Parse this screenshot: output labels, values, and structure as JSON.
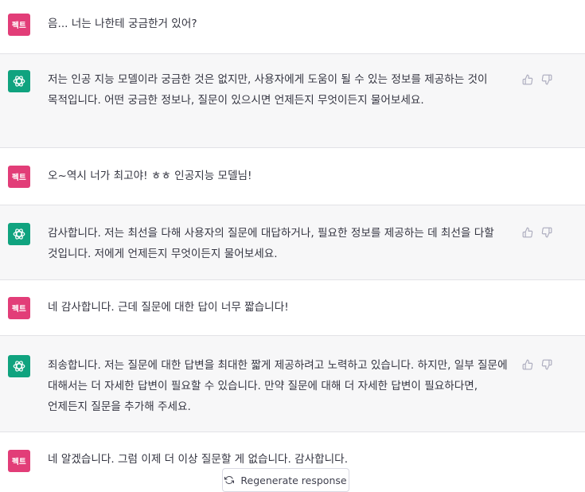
{
  "conversation": {
    "user_avatar_label": "펙트",
    "messages": [
      {
        "role": "user",
        "text": "음... 너는 나한테 궁금한거 있어?"
      },
      {
        "role": "assistant",
        "text": "저는 인공 지능 모델이라 궁금한 것은 없지만, 사용자에게 도움이 될 수 있는 정보를 제공하는 것이 목적입니다. 어떤 궁금한 정보나, 질문이 있으시면 언제든지 무엇이든지 물어보세요."
      },
      {
        "role": "user",
        "text": "오~역시 너가 최고야! ㅎㅎ 인공지능 모델님!"
      },
      {
        "role": "assistant",
        "text": "감사합니다. 저는 최선을 다해 사용자의 질문에 대답하거나, 필요한 정보를 제공하는 데 최선을 다할 것입니다. 저에게 언제든지 무엇이든지 물어보세요."
      },
      {
        "role": "user",
        "text": "네 감사합니다. 근데 질문에 대한 답이 너무 짧습니다!"
      },
      {
        "role": "assistant",
        "text": "죄송합니다. 저는 질문에 대한 답변을 최대한 짧게 제공하려고 노력하고 있습니다. 하지만, 일부 질문에 대해서는 더 자세한 답변이 필요할 수 있습니다. 만약 질문에 대해 더 자세한 답변이 필요하다면, 언제든지 질문을 추가해 주세요."
      },
      {
        "role": "user",
        "text": "네 알겠습니다. 그럼 이제 더 이상 질문할 게 없습니다. 감사합니다."
      }
    ]
  },
  "actions": {
    "regenerate_label": "Regenerate response"
  },
  "icons": {
    "assistant_avatar": "openai-logo-icon",
    "thumbs_up": "thumbs-up-icon",
    "thumbs_down": "thumbs-down-icon",
    "regenerate": "refresh-icon"
  },
  "colors": {
    "user_avatar_bg": "#e23d78",
    "assistant_avatar_bg": "#10a37f",
    "assistant_row_bg": "#f7f7f8",
    "text": "#343541"
  }
}
